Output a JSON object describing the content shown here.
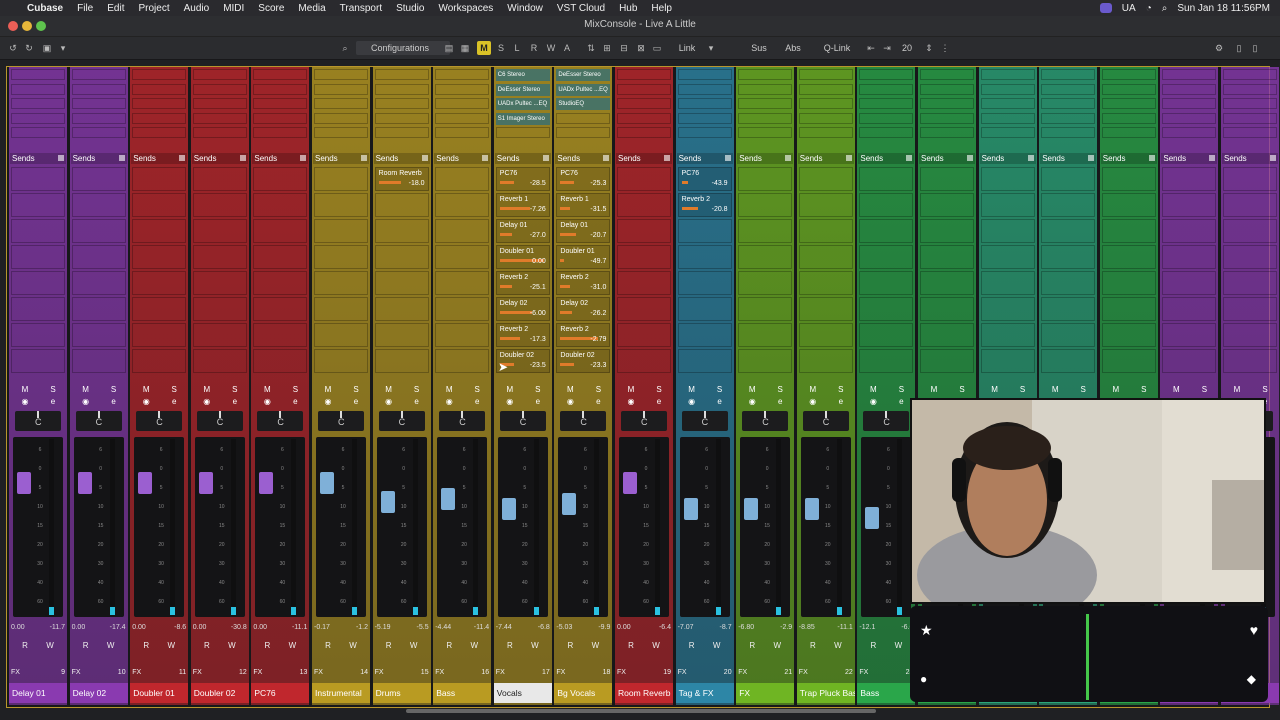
{
  "menubar": {
    "app": "Cubase",
    "items": [
      "File",
      "Edit",
      "Project",
      "Audio",
      "MIDI",
      "Score",
      "Media",
      "Transport",
      "Studio",
      "Workspaces",
      "Window",
      "VST Cloud",
      "Hub",
      "Help"
    ],
    "keyboard": "UA",
    "datetime": "Sun Jan 18  11:56PM"
  },
  "window": {
    "title": "MixConsole - Live A Little"
  },
  "toolbar": {
    "configurations": "Configurations",
    "m": "M",
    "s": "S",
    "l": "L",
    "r": "R",
    "w": "W",
    "a": "A",
    "link": "Link",
    "sus": "Sus",
    "abs": "Abs",
    "qlink": "Q-Link",
    "count": "20"
  },
  "sends_label": "Sends",
  "strip": {
    "m": "M",
    "s": "S",
    "e": "e",
    "pan": "C",
    "r": "R",
    "w": "W",
    "fx": "FX"
  },
  "channels": [
    {
      "name": "Delay 01",
      "num": "9",
      "color": "#8a3ab0",
      "v1": "0.00",
      "v2": "-11.7",
      "fader": 0.78,
      "sends": []
    },
    {
      "name": "Delay 02",
      "num": "10",
      "color": "#8a3ab0",
      "v1": "0.00",
      "v2": "-17.4",
      "fader": 0.78,
      "sends": []
    },
    {
      "name": "Doubler 01",
      "num": "11",
      "color": "#c0272d",
      "v1": "0.00",
      "v2": "-8.6",
      "fader": 0.78,
      "sends": []
    },
    {
      "name": "Doubler 02",
      "num": "12",
      "color": "#c0272d",
      "v1": "0.00",
      "v2": "-30.8",
      "fader": 0.78,
      "sends": []
    },
    {
      "name": "PC76",
      "num": "13",
      "color": "#c0272d",
      "v1": "0.00",
      "v2": "-11.1",
      "fader": 0.78,
      "sends": []
    },
    {
      "name": "Instrumental",
      "num": "14",
      "color": "#b99b22",
      "v1": "-0.17",
      "v2": "-1.2",
      "fader": 0.78,
      "sends": []
    },
    {
      "name": "Drums",
      "num": "15",
      "color": "#b99b22",
      "v1": "-5.19",
      "v2": "-5.5",
      "fader": 0.66,
      "sends": [
        {
          "n": "Room Reverb",
          "v": "-18.0",
          "w": 22
        }
      ]
    },
    {
      "name": "Bass",
      "num": "16",
      "color": "#b99b22",
      "v1": "-4.44",
      "v2": "-11.4",
      "fader": 0.68,
      "sends": []
    },
    {
      "name": "Vocals",
      "num": "17",
      "color": "#b99b22",
      "v1": "-7.44",
      "v2": "-6.8",
      "fader": 0.62,
      "inserts": [
        "C6 Stereo",
        "DeEsser Stereo",
        "UADx Pultec ...EQ",
        "S1 Imager Stereo"
      ],
      "sends": [
        {
          "n": "PC76",
          "v": "-28.5",
          "w": 14
        },
        {
          "n": "Reverb 1",
          "v": "-7.26",
          "w": 30
        },
        {
          "n": "Delay 01",
          "v": "-27.0",
          "w": 12
        },
        {
          "n": "Doubler 01",
          "v": "0.00",
          "w": 44
        },
        {
          "n": "Reverb 2",
          "v": "-25.1",
          "w": 12
        },
        {
          "n": "Delay 02",
          "v": "-6.00",
          "w": 32
        },
        {
          "n": "Reverb 2",
          "v": "-17.3",
          "w": 20
        },
        {
          "n": "Doubler 02",
          "v": "-23.5",
          "w": 14
        }
      ]
    },
    {
      "name": "Bg Vocals",
      "num": "18",
      "color": "#b99b22",
      "v1": "-5.03",
      "v2": "-9.9",
      "fader": 0.65,
      "inserts": [
        "DeEsser Stereo",
        "UADx Pultec ...EQ",
        "StudioEQ"
      ],
      "sends": [
        {
          "n": "PC76",
          "v": "-25.3",
          "w": 14
        },
        {
          "n": "Reverb 1",
          "v": "-31.5",
          "w": 10
        },
        {
          "n": "Delay 01",
          "v": "-20.7",
          "w": 16
        },
        {
          "n": "Doubler 01",
          "v": "-49.7",
          "w": 4
        },
        {
          "n": "Reverb 2",
          "v": "-31.0",
          "w": 10
        },
        {
          "n": "Delay 02",
          "v": "-26.2",
          "w": 12
        },
        {
          "n": "Reverb 2",
          "v": "-2.79",
          "w": 38
        },
        {
          "n": "Doubler 02",
          "v": "-23.3",
          "w": 14
        }
      ]
    },
    {
      "name": "Room Reverb",
      "num": "19",
      "color": "#c0272d",
      "v1": "0.00",
      "v2": "-6.4",
      "fader": 0.78,
      "sends": []
    },
    {
      "name": "Tag & FX",
      "num": "20",
      "color": "#2d86a6",
      "v1": "-7.07",
      "v2": "-8.7",
      "fader": 0.62,
      "sends": [
        {
          "n": "PC76",
          "v": "-43.9",
          "w": 6
        },
        {
          "n": "Reverb 2",
          "v": "-20.8",
          "w": 16
        }
      ]
    },
    {
      "name": "FX",
      "num": "21",
      "color": "#6fb523",
      "v1": "-6.80",
      "v2": "-2.9",
      "fader": 0.62,
      "sends": []
    },
    {
      "name": "Trap Pluck Bass",
      "num": "22",
      "color": "#6fb523",
      "v1": "-8.85",
      "v2": "-11.1",
      "fader": 0.62,
      "sends": []
    },
    {
      "name": "Bass",
      "num": "23",
      "color": "#2aa64a",
      "v1": "-12.1",
      "v2": "-6.6",
      "fader": 0.56,
      "sends": []
    },
    {
      "name": "",
      "num": "",
      "color": "#2aa64a",
      "v1": "",
      "v2": "",
      "fader": 0.5,
      "sends": []
    },
    {
      "name": "",
      "num": "",
      "color": "#2ba57a",
      "v1": "",
      "v2": "",
      "fader": 0.5,
      "sends": []
    },
    {
      "name": "",
      "num": "",
      "color": "#2ba57a",
      "v1": "",
      "v2": "",
      "fader": 0.5,
      "sends": []
    },
    {
      "name": "",
      "num": "",
      "color": "#2aa64a",
      "v1": "",
      "v2": "",
      "fader": 0.5,
      "sends": []
    },
    {
      "name": "",
      "num": "",
      "color": "#8a3ab0",
      "v1": "",
      "v2": "",
      "fader": 0.5,
      "sends": []
    },
    {
      "name": "",
      "num": "",
      "color": "#8a3ab0",
      "v1": "",
      "v2": "",
      "fader": 0.5,
      "sends": []
    }
  ],
  "scale_ticks": [
    "6",
    "0",
    "5",
    "10",
    "15",
    "20",
    "30",
    "40",
    "60"
  ]
}
